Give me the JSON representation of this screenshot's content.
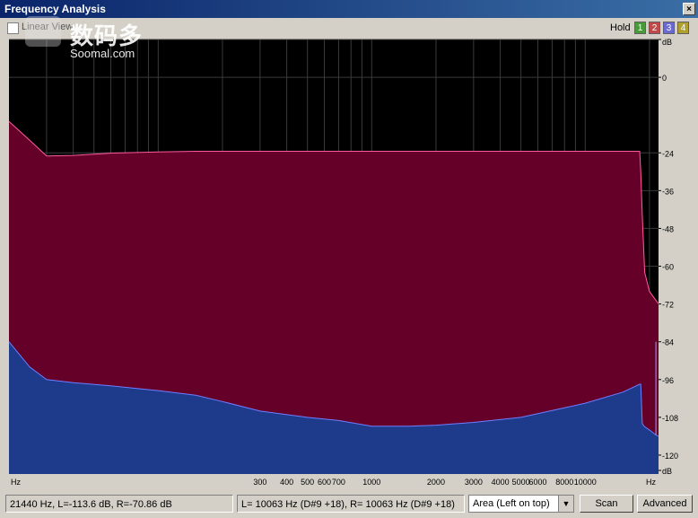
{
  "window": {
    "title": "Frequency Analysis",
    "close_glyph": "×"
  },
  "toolbar": {
    "linear_view_label": "Linear View",
    "linear_view_checked": false,
    "hold_label": "Hold",
    "hold_buttons": [
      {
        "label": "1",
        "color": "#4a9a3c"
      },
      {
        "label": "2",
        "color": "#c04a4a"
      },
      {
        "label": "3",
        "color": "#6a6ad0"
      },
      {
        "label": "4",
        "color": "#b0a030"
      }
    ]
  },
  "watermark": {
    "text": "数码多",
    "sub": "Soomal.com"
  },
  "colors": {
    "background": "#000000",
    "grid": "#3a3a3a",
    "area_upper": "#650029",
    "area_lower": "#1e3a8a",
    "line_upper": "#ff5aa0",
    "line_lower": "#6e7eff",
    "cursor": "#a0a0ff"
  },
  "chart_data": {
    "type": "area",
    "x_scale": "log",
    "x_unit": "Hz",
    "y_unit": "dB",
    "xlim": [
      20,
      22050
    ],
    "ylim": [
      -126,
      12
    ],
    "x_ticks": [
      300,
      400,
      500,
      600,
      700,
      1000,
      2000,
      3000,
      4000,
      5000,
      6000,
      8000,
      10000
    ],
    "x_tick_labels": [
      "300",
      "400",
      "500",
      "600",
      "700",
      "1000",
      "2000",
      "3000",
      "4000",
      "5000",
      "6000",
      "8000",
      "10000"
    ],
    "y_ticks": [
      12,
      0,
      -24,
      -36,
      -48,
      -60,
      -72,
      -84,
      -96,
      -108,
      -120
    ],
    "y_tick_labels": [
      "dB",
      "0",
      "-24",
      "-36",
      "-48",
      "-60",
      "-72",
      "-84",
      "-96",
      "-108",
      "-120",
      "dB"
    ],
    "x_axis_unit_label": "Hz",
    "series": [
      {
        "x": [
          20,
          25,
          30,
          40,
          60,
          100,
          150,
          300,
          1000,
          5000,
          15000,
          18000,
          18200,
          18500,
          19000,
          20000,
          21440,
          22050
        ],
        "y": [
          -14,
          -20,
          -25,
          -24.8,
          -24.1,
          -23.7,
          -23.5,
          -23.5,
          -23.5,
          -23.5,
          -23.5,
          -23.5,
          -30,
          -44,
          -62,
          -68,
          -70.86,
          -72
        ]
      },
      {
        "x": [
          20,
          25,
          30,
          40,
          60,
          100,
          150,
          200,
          300,
          500,
          700,
          1000,
          1500,
          2000,
          3000,
          5000,
          8000,
          10000,
          15000,
          18000,
          18200,
          18500,
          19000,
          20000,
          21440,
          22050
        ],
        "y": [
          -84,
          -92,
          -96,
          -97,
          -98,
          -99.5,
          -101,
          -103,
          -106,
          -108,
          -109,
          -110.8,
          -110.8,
          -110.5,
          -109.6,
          -108,
          -105,
          -103.5,
          -100,
          -97.5,
          -97.5,
          -110,
          -111,
          -112,
          -113.6,
          -114
        ]
      }
    ]
  },
  "status": {
    "cursor_readout": "21440 Hz, L=-113.6 dB, R=-70.86 dB",
    "peak_readout": "L= 10063 Hz (D#9 +18), R= 10063 Hz (D#9 +18)",
    "mode_select": "Area (Left on top)",
    "scan_label": "Scan",
    "advanced_label": "Advanced"
  }
}
